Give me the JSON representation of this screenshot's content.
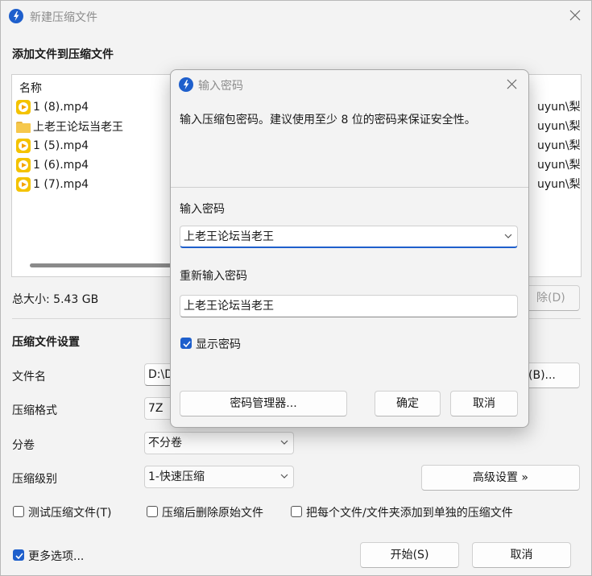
{
  "main": {
    "title": "新建压缩文件",
    "add_section_title": "添加文件到压缩文件",
    "column_name": "名称",
    "files": [
      {
        "name": "1 (8).mp4",
        "type": "mp4",
        "path": "uyun\\梨波"
      },
      {
        "name": "上老王论坛当老王",
        "type": "folder",
        "path": "uyun\\梨波"
      },
      {
        "name": "1 (5).mp4",
        "type": "mp4",
        "path": "uyun\\梨波"
      },
      {
        "name": "1 (6).mp4",
        "type": "mp4",
        "path": "uyun\\梨波"
      },
      {
        "name": "1 (7).mp4",
        "type": "mp4",
        "path": "uyun\\梨波"
      }
    ],
    "total_size": "总大小: 5.43 GB",
    "remove_button": "除(D)",
    "settings_title": "压缩文件设置",
    "filename_label": "文件名",
    "filename_value": "D:\\D",
    "browse_button": "(B)...",
    "format_label": "压缩格式",
    "format_value": "7Z",
    "volume_label": "分卷",
    "volume_value": "不分卷",
    "level_label": "压缩级别",
    "level_value": "1-快速压缩",
    "advanced_button": "高级设置 »",
    "test_checkbox": "测试压缩文件(T)",
    "delete_checkbox": "压缩后删除原始文件",
    "separate_checkbox": "把每个文件/文件夹添加到单独的压缩文件",
    "more_options_checkbox": "更多选项...",
    "start_button": "开始(S)",
    "cancel_button": "取消"
  },
  "dialog": {
    "title": "输入密码",
    "description": "输入压缩包密码。建议使用至少 8 位的密码来保证安全性。",
    "password_label": "输入密码",
    "password_value": "上老王论坛当老王",
    "reenter_label": "重新输入密码",
    "reenter_value": "上老王论坛当老王",
    "show_password_checkbox": "显示密码",
    "show_password_checked": true,
    "password_manager_button": "密码管理器...",
    "ok_button": "确定",
    "cancel_button": "取消"
  },
  "colors": {
    "accent": "#1e5fcc",
    "file_icon": "#f4c300",
    "background": "#f3f3f3"
  }
}
